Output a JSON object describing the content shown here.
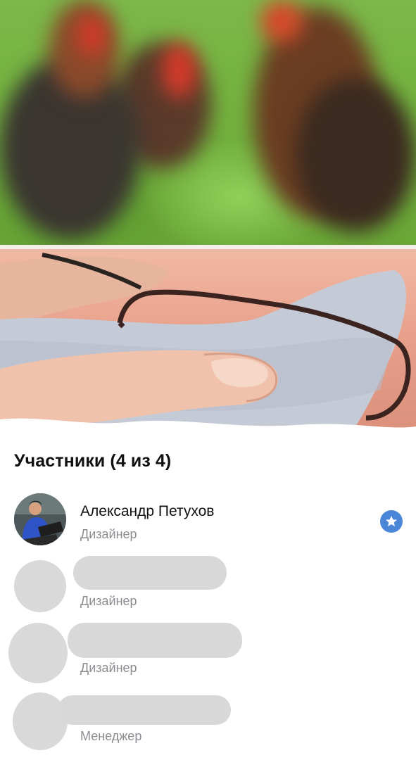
{
  "section": {
    "title": "Участники (4 из 4)"
  },
  "members": [
    {
      "name": "Александр Петухов",
      "role": "Дизайнер",
      "is_admin": true,
      "avatar_icon": "user-photo-icon"
    },
    {
      "name": "",
      "role": "Дизайнер",
      "is_admin": false,
      "avatar_icon": "avatar-icon"
    },
    {
      "name": "",
      "role": "Дизайнер",
      "is_admin": false,
      "avatar_icon": "avatar-icon"
    },
    {
      "name": "",
      "role": "Менеджер",
      "is_admin": false,
      "avatar_icon": "avatar-icon"
    }
  ],
  "colors": {
    "admin_badge": "#4a86d8",
    "role_text": "#8a8d91",
    "title_text": "#111111"
  },
  "icons": {
    "admin_badge": "star-badge-icon"
  }
}
